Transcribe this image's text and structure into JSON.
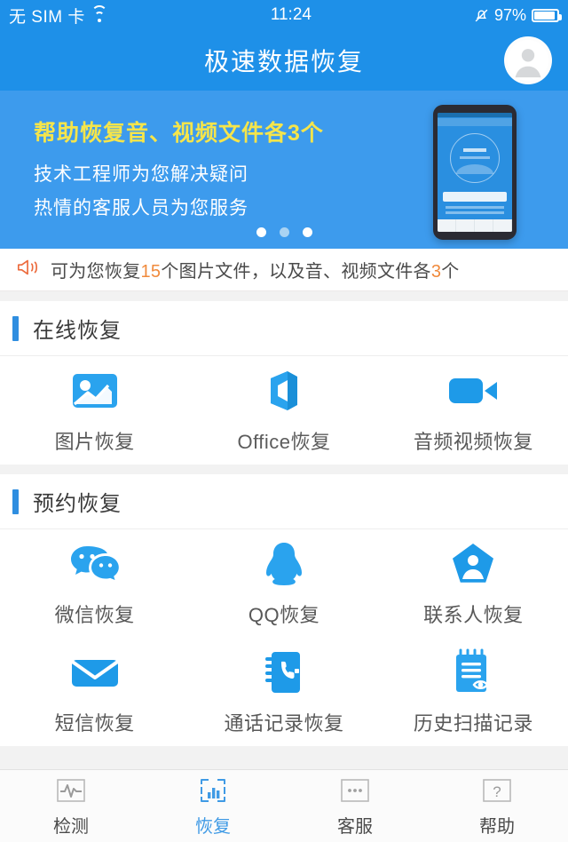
{
  "statusbar": {
    "carrier": "无 SIM 卡",
    "wifi_icon": "wifi-icon",
    "time": "11:24",
    "mute_icon": "bell-muted-icon",
    "battery_percent": "97%",
    "battery_icon": "battery-icon"
  },
  "appbar": {
    "title": "极速数据恢复",
    "avatar_icon": "user-avatar-icon"
  },
  "banner": {
    "headline": "帮助恢复音、视频文件各3个",
    "line1": "技术工程师为您解决疑问",
    "line2": "热情的客服人员为您服务",
    "dots": [
      {
        "active": true
      },
      {
        "active": false
      },
      {
        "active": true
      }
    ],
    "phone_mock_icon": "phone-mockup-illustration",
    "bg_color": "#3d9bed",
    "headline_color": "#f5e54b"
  },
  "notice": {
    "icon": "megaphone-icon",
    "prefix": "可为您恢复",
    "count_images": "15",
    "middle": "个图片文件，以及音、视频文件各",
    "count_media": "3",
    "suffix": "个",
    "highlight_color": "#f08a3c"
  },
  "sections": [
    {
      "title": "在线恢复",
      "accent_color": "#2f8ee0",
      "items": [
        {
          "label": "图片恢复",
          "icon": "image-recovery-icon"
        },
        {
          "label": "Office恢复",
          "icon": "office-recovery-icon"
        },
        {
          "label": "音频视频恢复",
          "icon": "video-recovery-icon"
        }
      ]
    },
    {
      "title": "预约恢复",
      "accent_color": "#2f8ee0",
      "items": [
        {
          "label": "微信恢复",
          "icon": "wechat-recovery-icon"
        },
        {
          "label": "QQ恢复",
          "icon": "qq-recovery-icon"
        },
        {
          "label": "联系人恢复",
          "icon": "contacts-recovery-icon"
        },
        {
          "label": "短信恢复",
          "icon": "sms-recovery-icon"
        },
        {
          "label": "通话记录恢复",
          "icon": "call-log-recovery-icon"
        },
        {
          "label": "历史扫描记录",
          "icon": "scan-history-icon"
        }
      ]
    }
  ],
  "tabbar": {
    "active_color": "#3f9ae5",
    "tabs": [
      {
        "label": "检测",
        "icon": "pulse-detect-icon",
        "active": false
      },
      {
        "label": "恢复",
        "icon": "bar-chart-recovery-icon",
        "active": true
      },
      {
        "label": "客服",
        "icon": "dots-service-icon",
        "active": false
      },
      {
        "label": "帮助",
        "icon": "question-help-icon",
        "active": false
      }
    ]
  }
}
